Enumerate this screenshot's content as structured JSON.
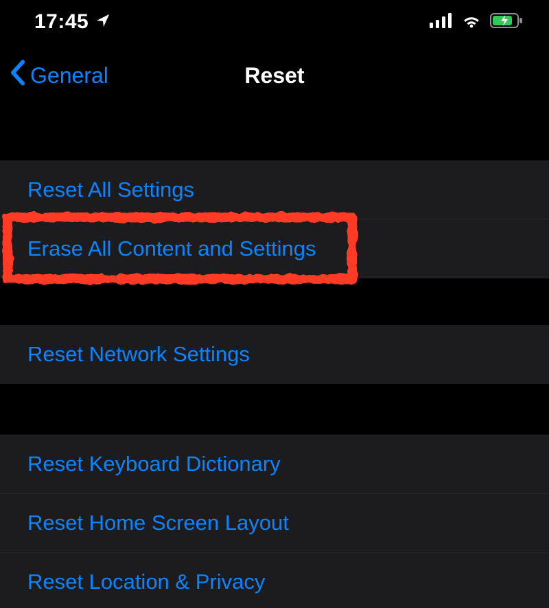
{
  "statusbar": {
    "time": "17:45"
  },
  "nav": {
    "back_label": "General",
    "title": "Reset"
  },
  "rows": {
    "reset_all": "Reset All Settings",
    "erase_all": "Erase All Content and Settings",
    "reset_network": "Reset Network Settings",
    "reset_keyboard": "Reset Keyboard Dictionary",
    "reset_home": "Reset Home Screen Layout",
    "reset_location": "Reset Location & Privacy"
  },
  "annotation": {
    "highlighted_row": "erase_all",
    "color": "#ff3b25"
  }
}
